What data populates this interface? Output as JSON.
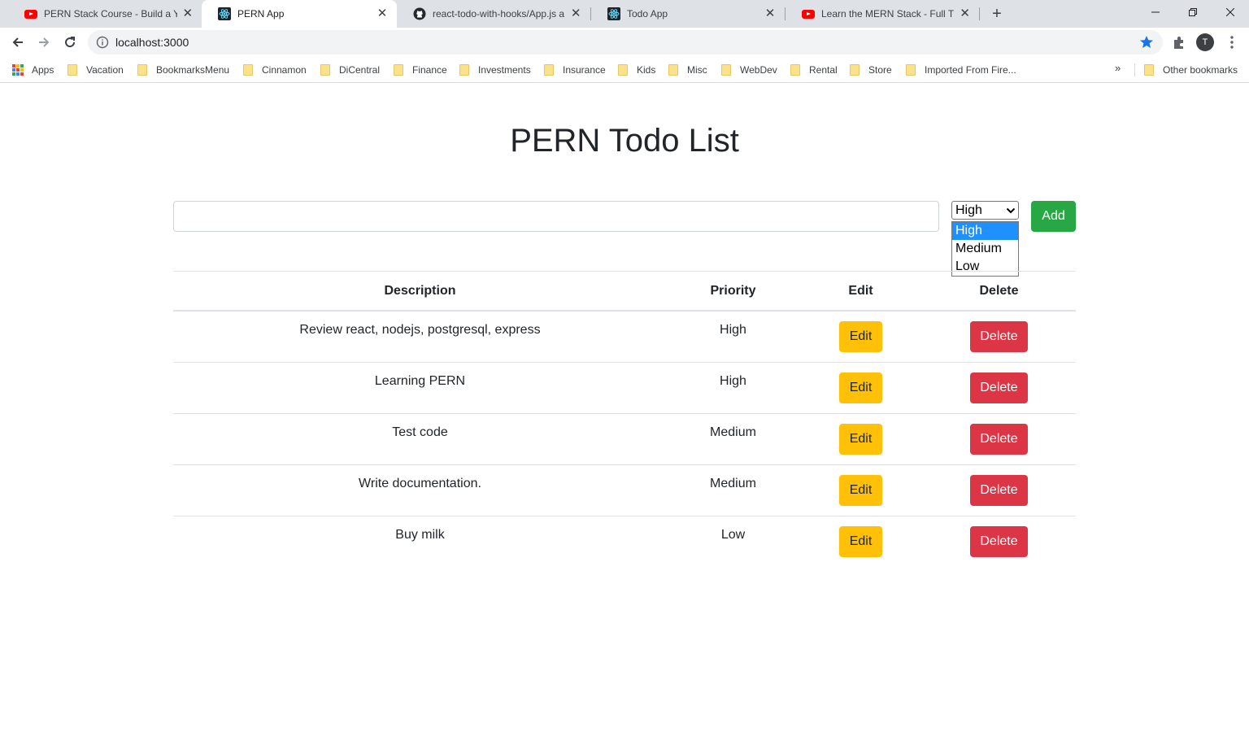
{
  "browser": {
    "tabs": [
      {
        "title": "PERN Stack Course - Build a Yelp",
        "icon": "youtube-icon"
      },
      {
        "title": "PERN App",
        "icon": "react-icon"
      },
      {
        "title": "react-todo-with-hooks/App.js at",
        "icon": "github-icon"
      },
      {
        "title": "Todo App",
        "icon": "react-icon"
      },
      {
        "title": "Learn the MERN Stack - Full Tuto",
        "icon": "youtube-icon"
      }
    ],
    "active_tab": 1,
    "url": "localhost:3000",
    "profile_initial": "T",
    "bookmarks": [
      "Apps",
      "Vacation",
      "BookmarksMenu",
      "Cinnamon",
      "DiCentral",
      "Finance",
      "Investments",
      "Insurance",
      "Kids",
      "Misc",
      "WebDev",
      "Rental",
      "Store",
      "Imported From Fire..."
    ],
    "overflow_label": "»",
    "other_bookmarks": "Other bookmarks",
    "accent_color": "#1a73e8"
  },
  "app": {
    "title": "PERN Todo List",
    "input_value": "",
    "priority_selected": "High",
    "priority_options": [
      "High",
      "Medium",
      "Low"
    ],
    "add_label": "Add",
    "columns": {
      "description": "Description",
      "priority": "Priority",
      "edit": "Edit",
      "delete": "Delete"
    },
    "todos": [
      {
        "description": "Review react, nodejs, postgresql, express",
        "priority": "High"
      },
      {
        "description": "Learning PERN",
        "priority": "High"
      },
      {
        "description": "Test code",
        "priority": "Medium"
      },
      {
        "description": "Write documentation.",
        "priority": "Medium"
      },
      {
        "description": "Buy milk",
        "priority": "Low"
      }
    ],
    "edit_label": "Edit",
    "delete_label": "Delete",
    "colors": {
      "add": "#28a745",
      "edit": "#ffc107",
      "delete": "#dc3545",
      "option_highlight": "#1e90ff"
    }
  }
}
